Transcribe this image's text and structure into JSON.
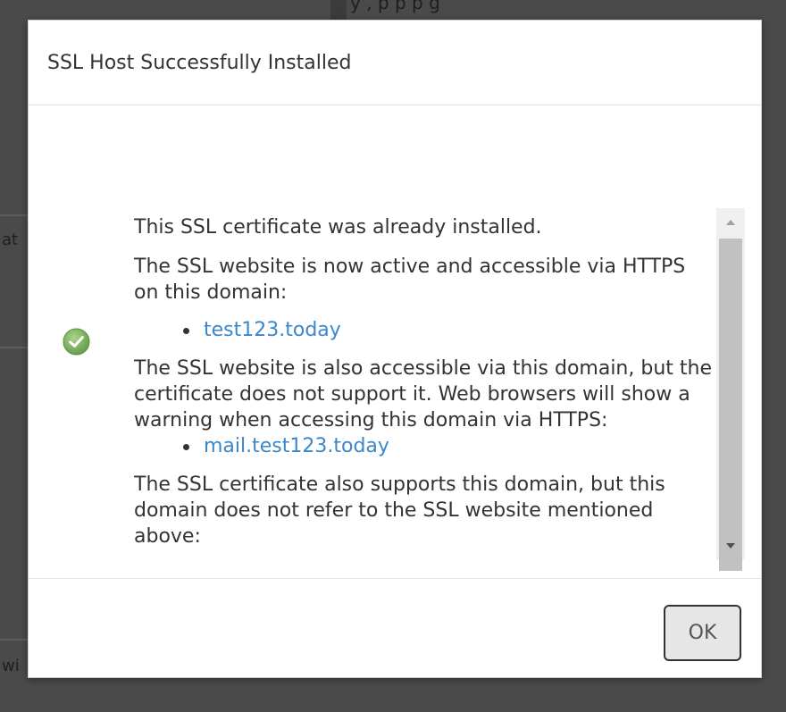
{
  "background": {
    "top_text": "y                                ,          p p p    g",
    "side_text_1": "at",
    "side_text_2": "wi"
  },
  "dialog": {
    "title": "SSL Host Successfully Installed",
    "status_icon": "check-circle-icon",
    "paragraphs": {
      "already_installed": "This SSL certificate was already installed.",
      "active": "The SSL website is now active and accessible via HTTPS on this domain:",
      "also_accessible": "The SSL website is also accessible via this domain, but the certificate does not support it. Web browsers will show a warning when accessing this domain via HTTPS:",
      "also_supports": "The SSL certificate also supports this domain, but this domain does not refer to the SSL website mentioned above:"
    },
    "active_domains": [
      "test123.today"
    ],
    "unsupported_domains": [
      "mail.test123.today"
    ],
    "ok_label": "OK"
  },
  "colors": {
    "link": "#3a87c9",
    "success": "#72b05a",
    "overlay": "#4a4a4a"
  }
}
